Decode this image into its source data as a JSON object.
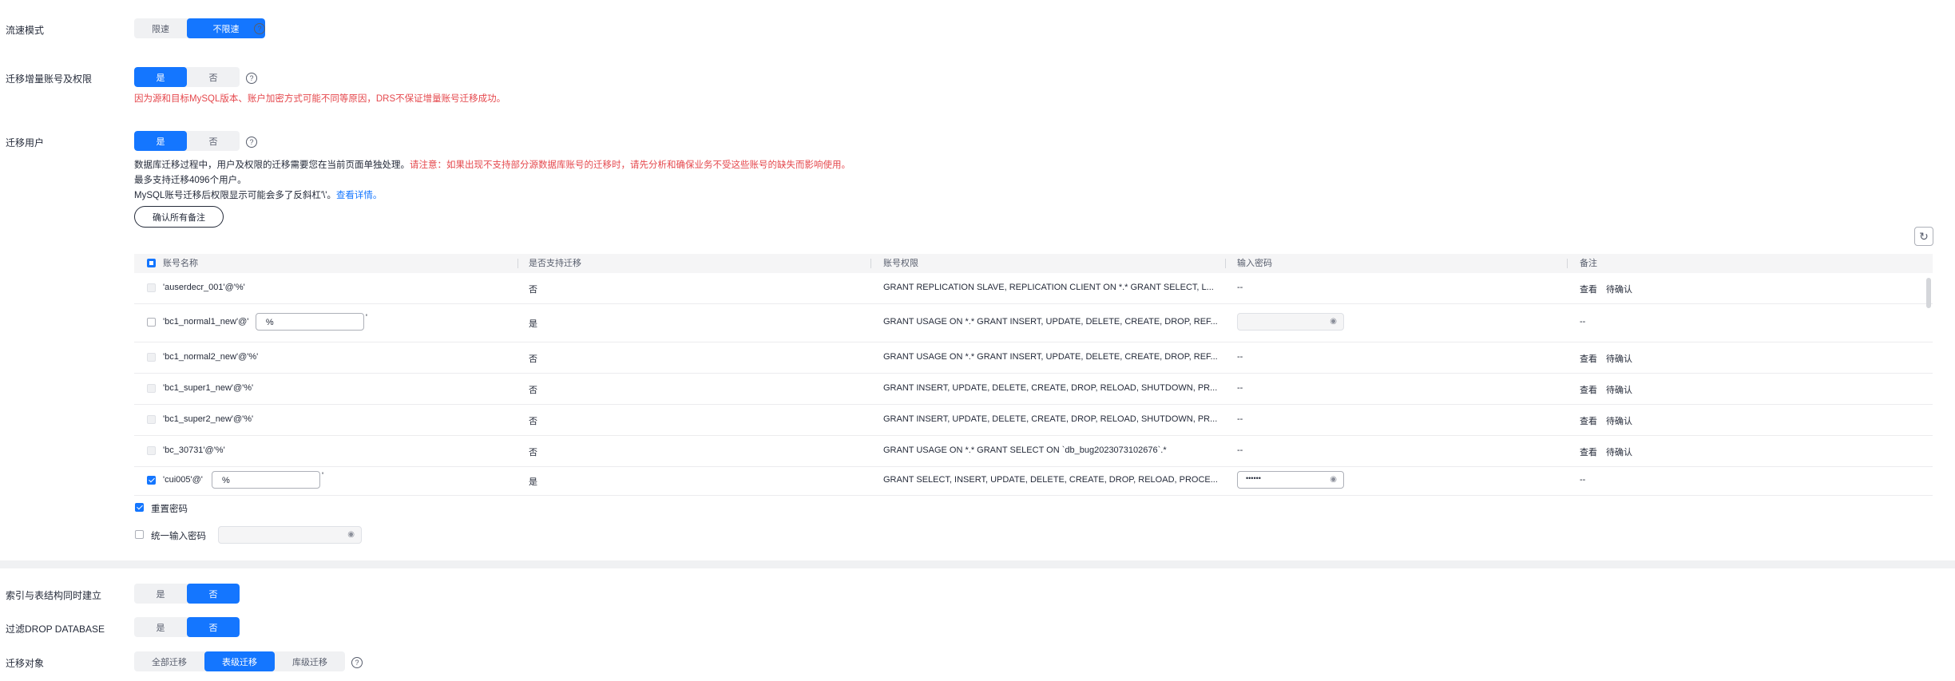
{
  "throttle": {
    "label": "流速模式",
    "options": [
      "限速",
      "不限速"
    ],
    "selected": 1
  },
  "migrate_accounts": {
    "label": "迁移增量账号及权限",
    "options": [
      "是",
      "否"
    ],
    "selected": 0,
    "warning": "因为源和目标MySQL版本、账户加密方式可能不同等原因，DRS不保证增量账号迁移成功。"
  },
  "migrate_users": {
    "label": "迁移用户",
    "options": [
      "是",
      "否"
    ],
    "selected": 0,
    "desc1_prefix": "数据库迁移过程中，用户及权限的迁移需要您在当前页面单独处理。",
    "desc1_warning": "请注意：如果出现不支持部分源数据库账号的迁移时，请先分析和确保业务不受这些账号的缺失而影响使用。",
    "desc2": "最多支持迁移4096个用户。",
    "desc3_prefix": "MySQL账号迁移后权限显示可能会多了反斜杠'\\'。",
    "desc3_link": "查看详情。",
    "confirm_all_btn": "确认所有备注"
  },
  "table": {
    "columns": [
      "账号名称",
      "是否支持迁移",
      "账号权限",
      "输入密码",
      "备注"
    ],
    "rows": [
      {
        "checked": false,
        "editable": false,
        "name": "'auserdecr_001'@'%'",
        "name_suffix": "",
        "host": "",
        "supported": "否",
        "privileges": "GRANT REPLICATION SLAVE, REPLICATION CLIENT ON *.* GRANT SELECT, L...",
        "password": "--",
        "pwd_field": false,
        "pwd_mask": "",
        "view_link": "查看",
        "status": "待确认",
        "remark": ""
      },
      {
        "checked": false,
        "editable": true,
        "name": "'bc1_normal1_new'@'",
        "name_suffix": "'",
        "host": "%",
        "supported": "是",
        "privileges": "GRANT USAGE ON *.* GRANT INSERT, UPDATE, DELETE, CREATE, DROP, REF...",
        "password": "",
        "pwd_field": true,
        "pwd_mask": "",
        "view_link": "",
        "status": "",
        "remark": "--"
      },
      {
        "checked": false,
        "editable": false,
        "name": "'bc1_normal2_new'@'%'",
        "name_suffix": "",
        "host": "",
        "supported": "否",
        "privileges": "GRANT USAGE ON *.* GRANT INSERT, UPDATE, DELETE, CREATE, DROP, REF...",
        "password": "--",
        "pwd_field": false,
        "pwd_mask": "",
        "view_link": "查看",
        "status": "待确认",
        "remark": ""
      },
      {
        "checked": false,
        "editable": false,
        "name": "'bc1_super1_new'@'%'",
        "name_suffix": "",
        "host": "",
        "supported": "否",
        "privileges": "GRANT INSERT, UPDATE, DELETE, CREATE, DROP, RELOAD, SHUTDOWN, PR...",
        "password": "--",
        "pwd_field": false,
        "pwd_mask": "",
        "view_link": "查看",
        "status": "待确认",
        "remark": ""
      },
      {
        "checked": false,
        "editable": false,
        "name": "'bc1_super2_new'@'%'",
        "name_suffix": "",
        "host": "",
        "supported": "否",
        "privileges": "GRANT INSERT, UPDATE, DELETE, CREATE, DROP, RELOAD, SHUTDOWN, PR...",
        "password": "--",
        "pwd_field": false,
        "pwd_mask": "",
        "view_link": "查看",
        "status": "待确认",
        "remark": ""
      },
      {
        "checked": false,
        "editable": false,
        "name": "'bc_30731'@'%'",
        "name_suffix": "",
        "host": "",
        "supported": "否",
        "privileges": "GRANT USAGE ON *.* GRANT SELECT ON `db_bug2023073102676`.*",
        "password": "--",
        "pwd_field": false,
        "pwd_mask": "",
        "view_link": "查看",
        "status": "待确认",
        "remark": ""
      },
      {
        "checked": true,
        "editable": true,
        "name": "'cui005'@'",
        "name_suffix": "'",
        "host": "%",
        "supported": "是",
        "privileges": "GRANT SELECT, INSERT, UPDATE, DELETE, CREATE, DROP, RELOAD, PROCE...",
        "password": "",
        "pwd_field": true,
        "pwd_mask": "••••••",
        "view_link": "",
        "status": "",
        "remark": "--"
      }
    ]
  },
  "reset_password": {
    "label": "重置密码",
    "checked": true
  },
  "unified_password": {
    "label": "统一输入密码",
    "checked": false
  },
  "index_build": {
    "label": "索引与表结构同时建立",
    "options": [
      "是",
      "否"
    ],
    "selected": 1
  },
  "filter_drop": {
    "label": "过滤DROP DATABASE",
    "options": [
      "是",
      "否"
    ],
    "selected": 1
  },
  "migrate_objects": {
    "label": "迁移对象",
    "options": [
      "全部迁移",
      "表级迁移",
      "库级迁移"
    ],
    "selected": 1
  },
  "colors": {
    "accent": "#1476ff",
    "warning": "#e5484d"
  },
  "icons": {
    "help": "help-circle-icon",
    "refresh": "refresh-icon",
    "eye": "eye-icon"
  }
}
